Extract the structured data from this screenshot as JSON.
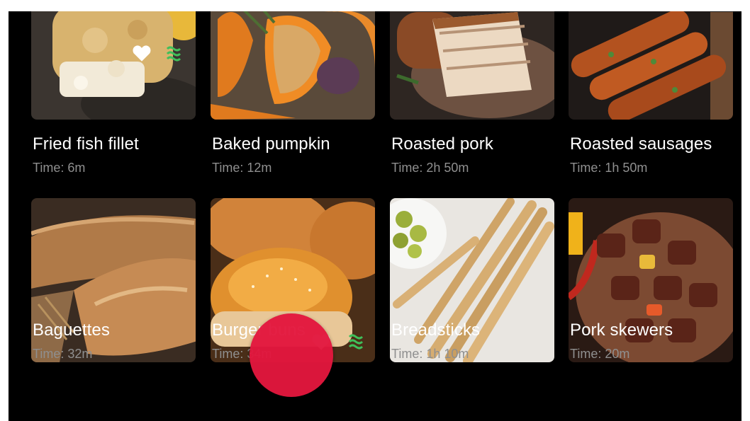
{
  "recipes": [
    {
      "title": "Fried fish fillet",
      "time": "Time: 6m"
    },
    {
      "title": "Baked pumpkin",
      "time": "Time: 12m"
    },
    {
      "title": "Roasted pork",
      "time": "Time: 2h 50m"
    },
    {
      "title": "Roasted sausages",
      "time": "Time: 1h 50m"
    },
    {
      "title": "Baguettes",
      "time": "Time: 32m"
    },
    {
      "title": "Burger buns",
      "time": "Time: 34m"
    },
    {
      "title": "Breadsticks",
      "time": "Time: 1h 10m"
    },
    {
      "title": "Pork skewers",
      "time": "Time: 20m"
    }
  ],
  "colors": {
    "background": "#000000",
    "title_text": "#ffffff",
    "time_text": "#8f8f8f",
    "fab": "#e3173e",
    "accent_green": "#3fbf5a"
  },
  "icons": {
    "favorite": "heart-icon",
    "vegetarian": "green-waves-icon"
  }
}
